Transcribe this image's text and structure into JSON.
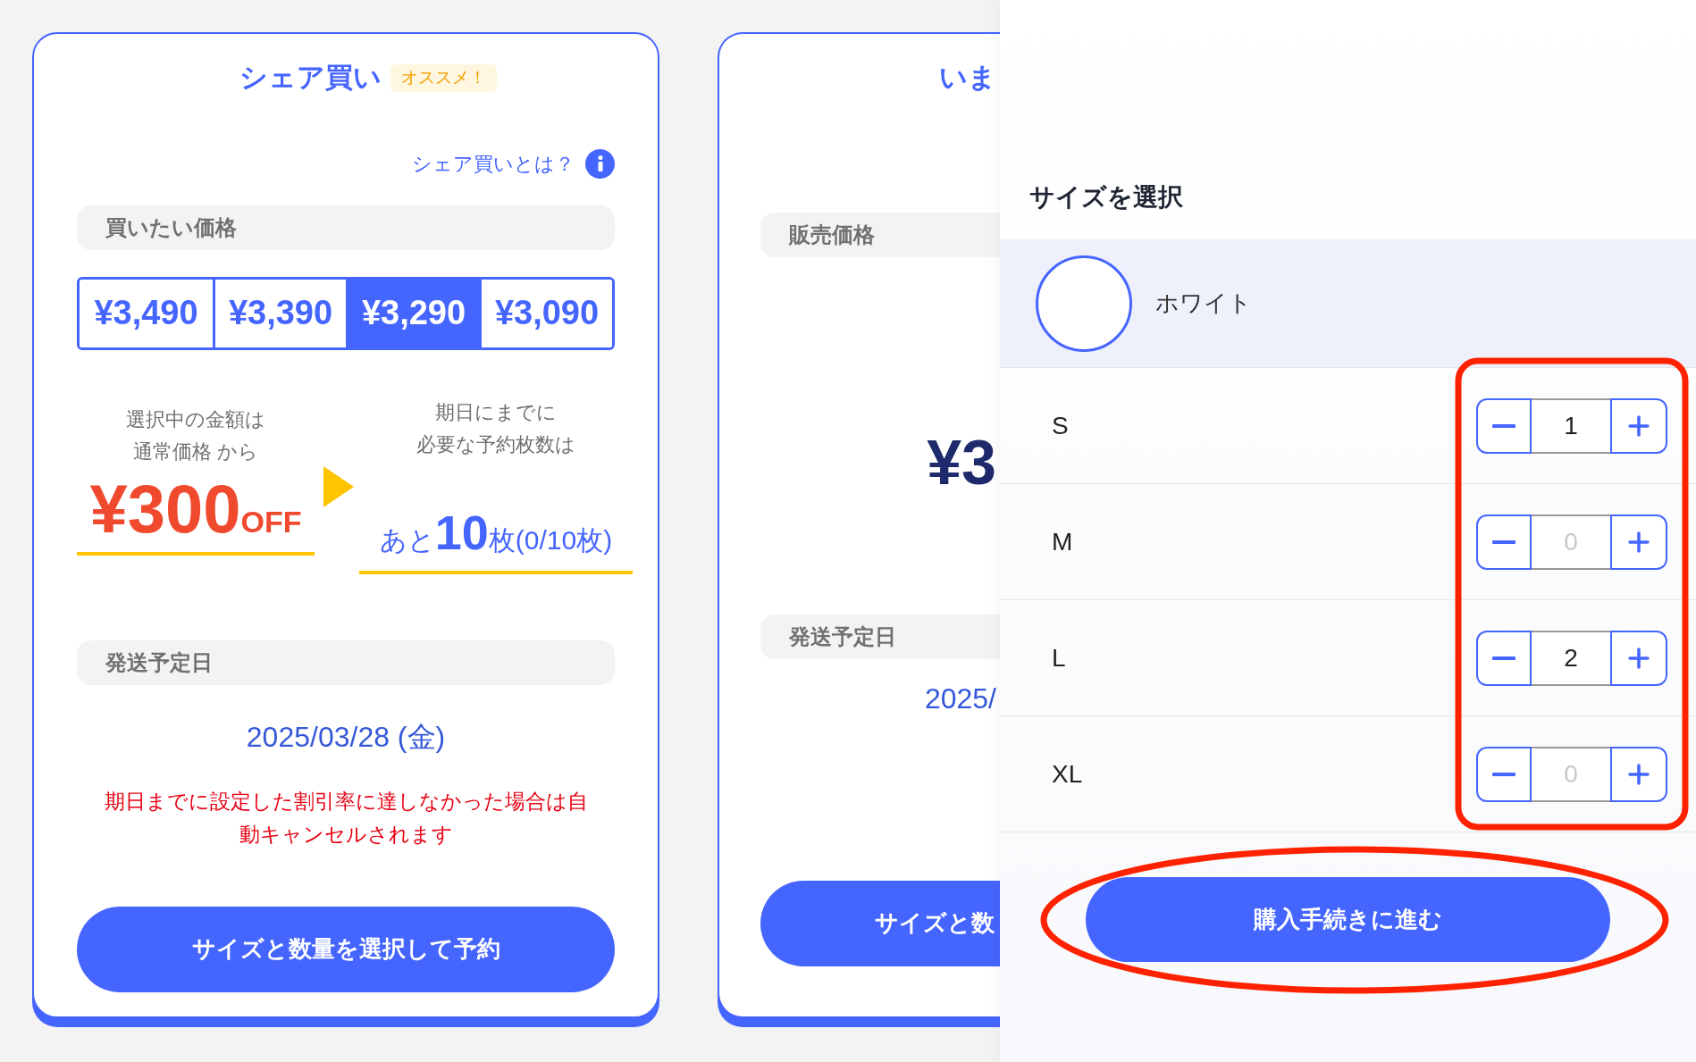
{
  "share_card": {
    "title": "シェア買い",
    "badge": "オススメ！",
    "help_link": "シェア買いとは？",
    "price_label": "買いたい価格",
    "price_options": [
      {
        "label": "¥3,490",
        "selected": false
      },
      {
        "label": "¥3,390",
        "selected": false
      },
      {
        "label": "¥3,290",
        "selected": true
      },
      {
        "label": "¥3,090",
        "selected": false
      }
    ],
    "discount_note": [
      "選択中の金額は",
      "通常価格 から"
    ],
    "discount_amount": "¥300",
    "discount_suffix": "OFF",
    "required_note": [
      "期日にまでに",
      "必要な予約枚数は"
    ],
    "remaining_prefix": "あと",
    "remaining_count": "10",
    "remaining_suffix": "枚(0/10枚)",
    "ship_label": "発送予定日",
    "ship_date": "2025/03/28 (金)",
    "warning": "期日までに設定した割引率に達しなかった場合は自動キャンセルされます",
    "reserve_button": "サイズと数量を選択して予約"
  },
  "now_card": {
    "title": "いま",
    "price_label": "販売価格",
    "price": "¥3",
    "ship_label": "発送予定日",
    "ship_date": "2025/",
    "button": "サイズと数"
  },
  "size_panel": {
    "title": "サイズを選択",
    "color": {
      "name": "ホワイト",
      "selected": true
    },
    "sizes": [
      {
        "label": "S",
        "value": "1"
      },
      {
        "label": "M",
        "placeholder": "0"
      },
      {
        "label": "L",
        "value": "2"
      },
      {
        "label": "XL",
        "placeholder": "0"
      }
    ],
    "checkout_button": "購入手続きに進む"
  }
}
